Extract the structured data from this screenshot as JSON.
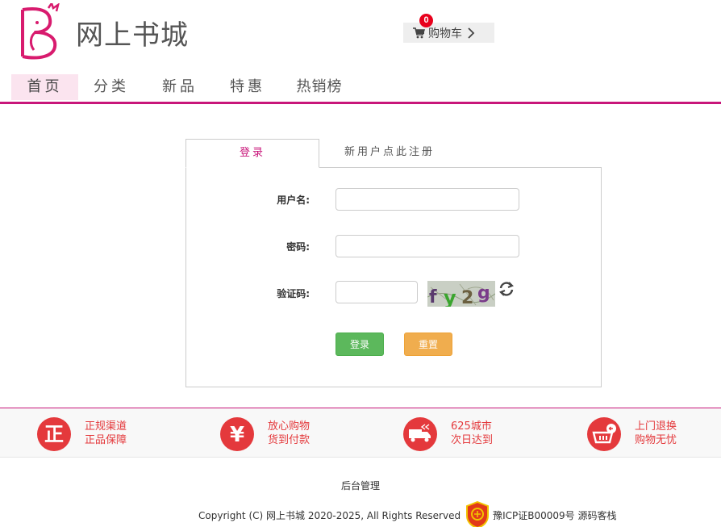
{
  "header": {
    "site_title": "网上书城",
    "cart_label": "购物车",
    "cart_count": "0"
  },
  "nav": {
    "items": [
      {
        "label": "首页",
        "active": true
      },
      {
        "label": "分类",
        "active": false
      },
      {
        "label": "新品",
        "active": false
      },
      {
        "label": "特惠",
        "active": false
      },
      {
        "label": "热销榜",
        "active": false
      }
    ]
  },
  "login": {
    "tab_login": "登录",
    "tab_register": "新用户点此注册",
    "username_label": "用户名:",
    "username_value": "",
    "password_label": "密码:",
    "password_value": "",
    "captcha_label": "验证码:",
    "captcha_value": "",
    "captcha_text": "fy2g",
    "login_button": "登录",
    "reset_button": "重置"
  },
  "services": [
    {
      "icon": "genuine-icon",
      "line1": "正规渠道",
      "line2": "正品保障"
    },
    {
      "icon": "yuan-icon",
      "line1": "放心购物",
      "line2": "货到付款"
    },
    {
      "icon": "delivery-truck-icon",
      "line1": "625城市",
      "line2": "次日达到"
    },
    {
      "icon": "return-basket-icon",
      "line1": "上门退换",
      "line2": "购物无忧"
    }
  ],
  "footer": {
    "admin_link": "后台管理",
    "copyright": "Copyright (C) 网上书城 2020-2025, All Rights Reserved",
    "icp": "豫ICP证B00009号 源码客栈"
  },
  "colors": {
    "brand": "#c8167a",
    "service_red": "#e4393c",
    "login_green": "#5cb85c",
    "reset_orange": "#f0ad4e"
  }
}
